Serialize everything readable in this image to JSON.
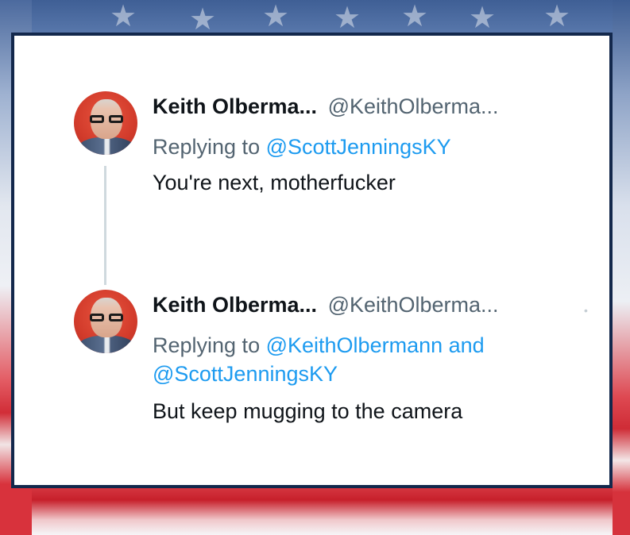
{
  "background": {
    "theme": "american-flag-broadcast",
    "colors": {
      "blue": "#3f5f95",
      "red": "#d7313b",
      "white": "#ffffff",
      "frame": "#13284c"
    }
  },
  "tweets": [
    {
      "display_name": "Keith Olberma...",
      "handle": "@KeithOlberma...",
      "reply_prefix": "Replying to",
      "reply_mentions": "@ScottJenningsKY",
      "reply_mentions_2": "",
      "text": "You're next, motherfucker",
      "avatar": "keith-olbermann-avatar"
    },
    {
      "display_name": "Keith Olberma...",
      "handle": "@KeithOlberma...",
      "reply_prefix": "Replying to",
      "reply_mentions": "@KeithOlbermann and",
      "reply_mentions_2": "@ScottJenningsKY",
      "text": "But keep mugging to the camera",
      "avatar": "keith-olbermann-avatar"
    }
  ],
  "colors": {
    "link": "#1d9bf0",
    "secondary_text": "#536471",
    "primary_text": "#0f1419",
    "thread_line": "#cfd9de"
  }
}
